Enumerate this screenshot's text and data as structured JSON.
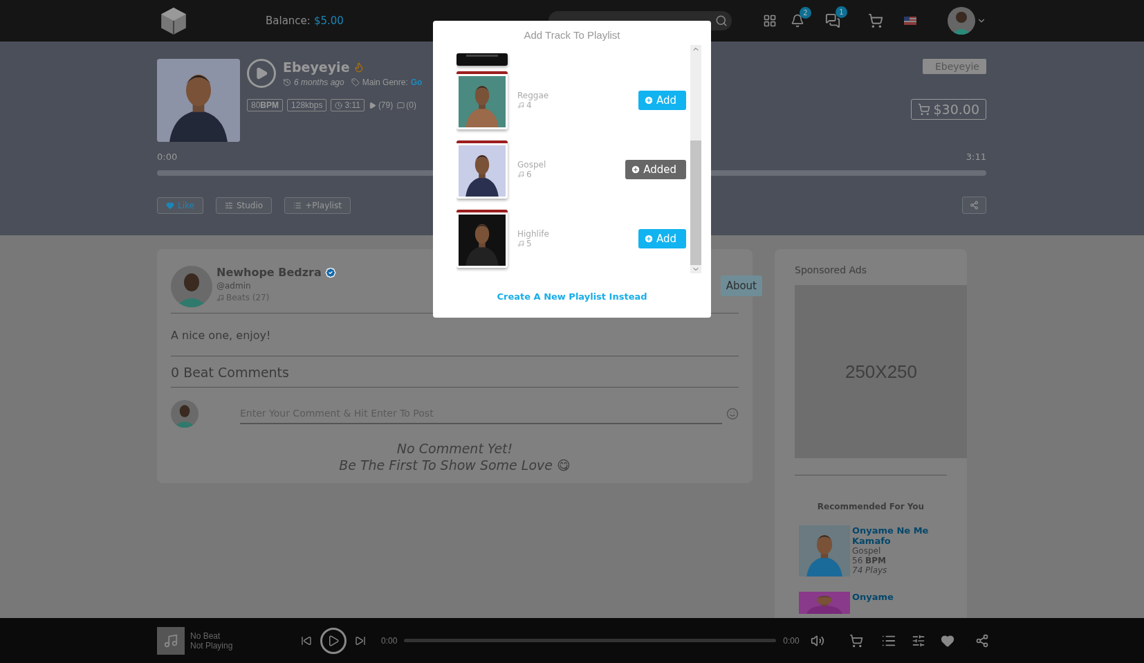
{
  "header": {
    "balance_label": "Balance:",
    "balance": "$5.00",
    "notifications": "2",
    "messages": "1"
  },
  "track": {
    "title": "Ebeyeyie",
    "posted": "6 months ago",
    "genre_label": "Main Genre:",
    "genre": "Go",
    "bpm": "80**BPM**",
    "bitrate": "128kbps",
    "duration": "3:11",
    "plays": "(79)",
    "comments": "(0)",
    "tag": "Ebeyeyie",
    "price": "$30.00",
    "time_start": "0:00",
    "time_end": "3:11",
    "level": 0
  },
  "actions": [
    {
      "label": "Like",
      "kind": "like"
    },
    {
      "label": "Studio",
      "kind": "studio"
    },
    {
      "label": "+Playlist",
      "kind": "playlist"
    }
  ],
  "author": {
    "name": "Newhope Bedzra",
    "handle": "@admin",
    "beats": "Beats (27)",
    "about": "About"
  },
  "description": "A nice one, enjoy!",
  "comments": {
    "title": "0 Beat Comments",
    "placeholder": "Enter Your Comment & Hit Enter To Post",
    "empty_line_1": "No Comment Yet!",
    "empty_line_2": "Be The First To Show Some Love 😋"
  },
  "sidebar": {
    "ads_title": "Sponsored Ads",
    "ad": "250X250",
    "recommended_title": "Recommended For You",
    "items": [
      {
        "title": "Onyame Ne Me Kamafo",
        "genre": "Gospel",
        "bpm": "56 **BPM**",
        "plays": "74 Plays"
      },
      {
        "title": "Onyame"
      }
    ]
  },
  "player": {
    "title": "No Beat",
    "status": "Not Playing",
    "time_start": "0:00",
    "time_end": "0:00",
    "level": 0
  },
  "modal": {
    "title": "Add Track To Playlist",
    "playlists": [
      {
        "name": "Reggae",
        "count": "4",
        "added": false,
        "button": "Add"
      },
      {
        "name": "Gospel",
        "count": "6",
        "added": true,
        "button": "Added"
      },
      {
        "name": "Highlife",
        "count": "5",
        "added": false,
        "button": "Add"
      }
    ],
    "create_link": "Create A New Playlist Instead"
  }
}
